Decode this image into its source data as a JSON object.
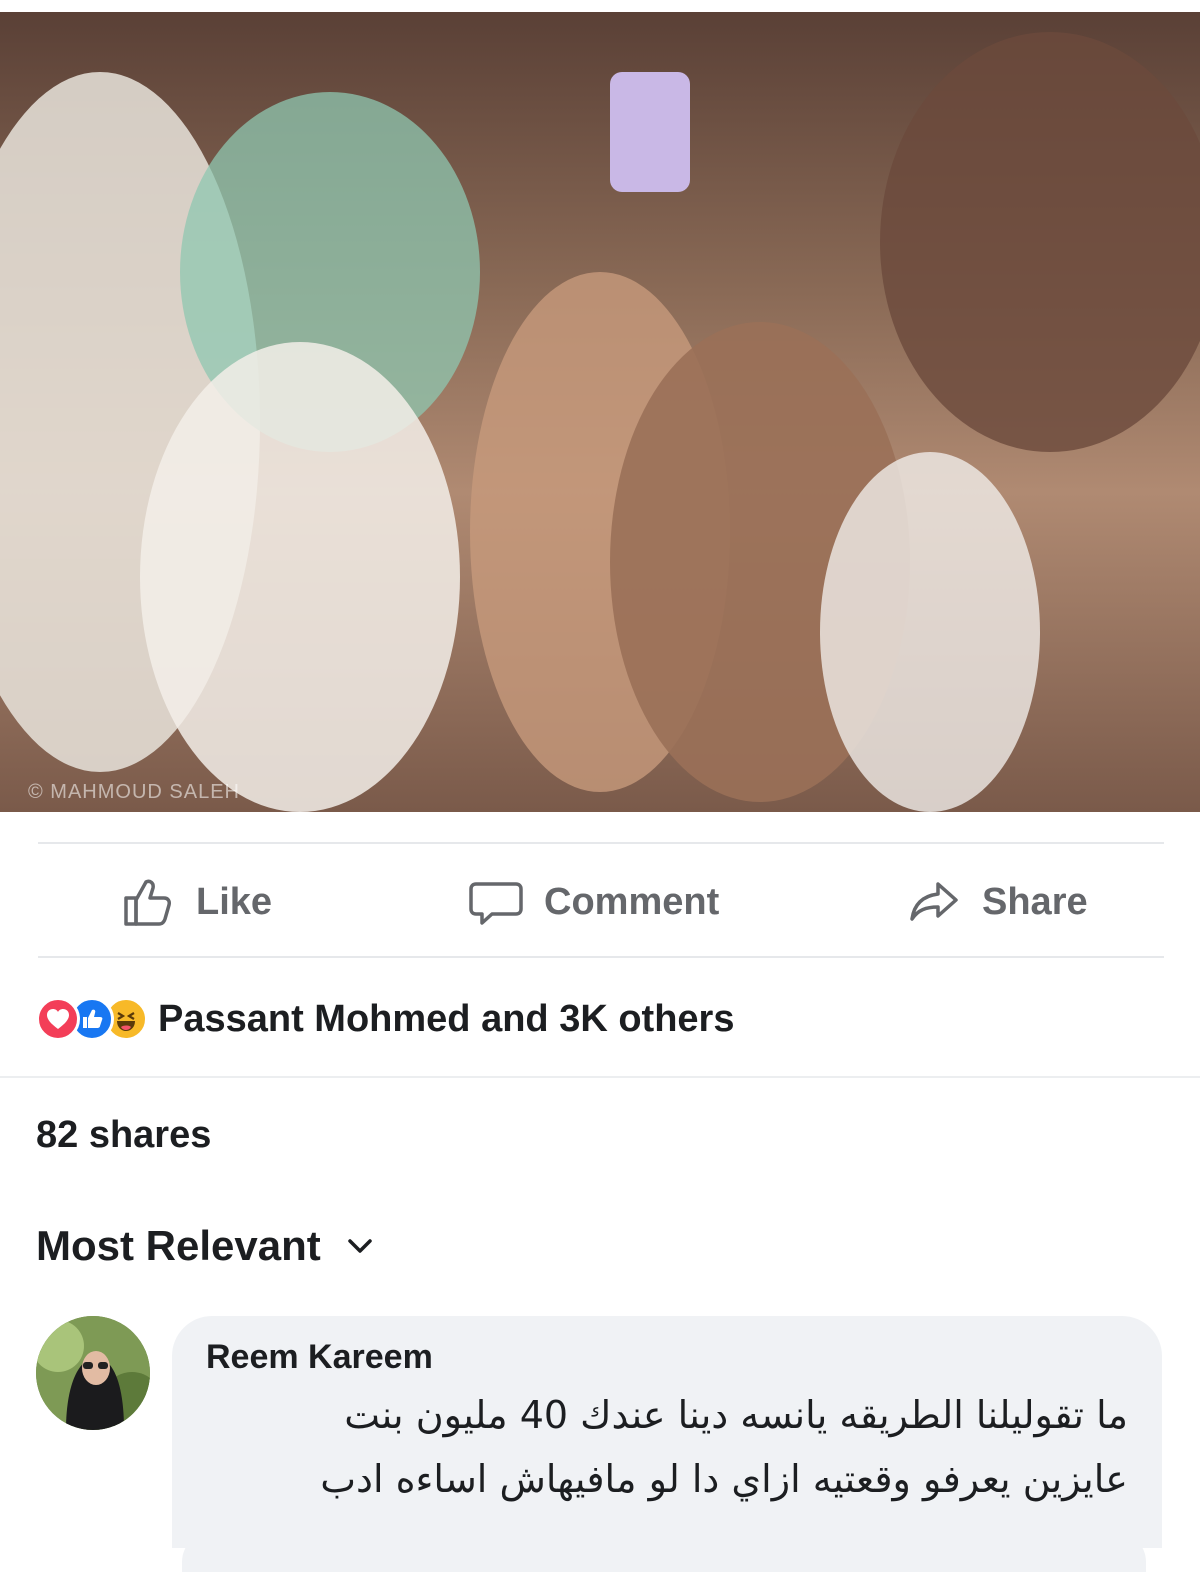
{
  "photo": {
    "alt": "Crowd of people cheering at a concert",
    "watermark": "© MAHMOUD SALEH"
  },
  "actions": {
    "like_label": "Like",
    "comment_label": "Comment",
    "share_label": "Share"
  },
  "reactions": {
    "summary": "Passant Mohmed and 3K others",
    "icons": [
      "love-reaction",
      "like-reaction",
      "haha-reaction"
    ]
  },
  "stats": {
    "shares": "82 shares"
  },
  "comments_sort": {
    "label": "Most Relevant"
  },
  "comment": {
    "author": "Reem Kareem",
    "line1": "ما تقوليلنا الطريقه يانسه دينا عندك 40 مليون بنت",
    "line2": "عايزين يعرفو وقعتيه ازاي دا لو مافيهاش اساءه ادب"
  },
  "colors": {
    "action_gray": "#65676b",
    "love_red": "#f33e58",
    "like_blue": "#1877f2",
    "haha_yellow": "#f7b928",
    "bubble_bg": "#f0f2f5"
  }
}
